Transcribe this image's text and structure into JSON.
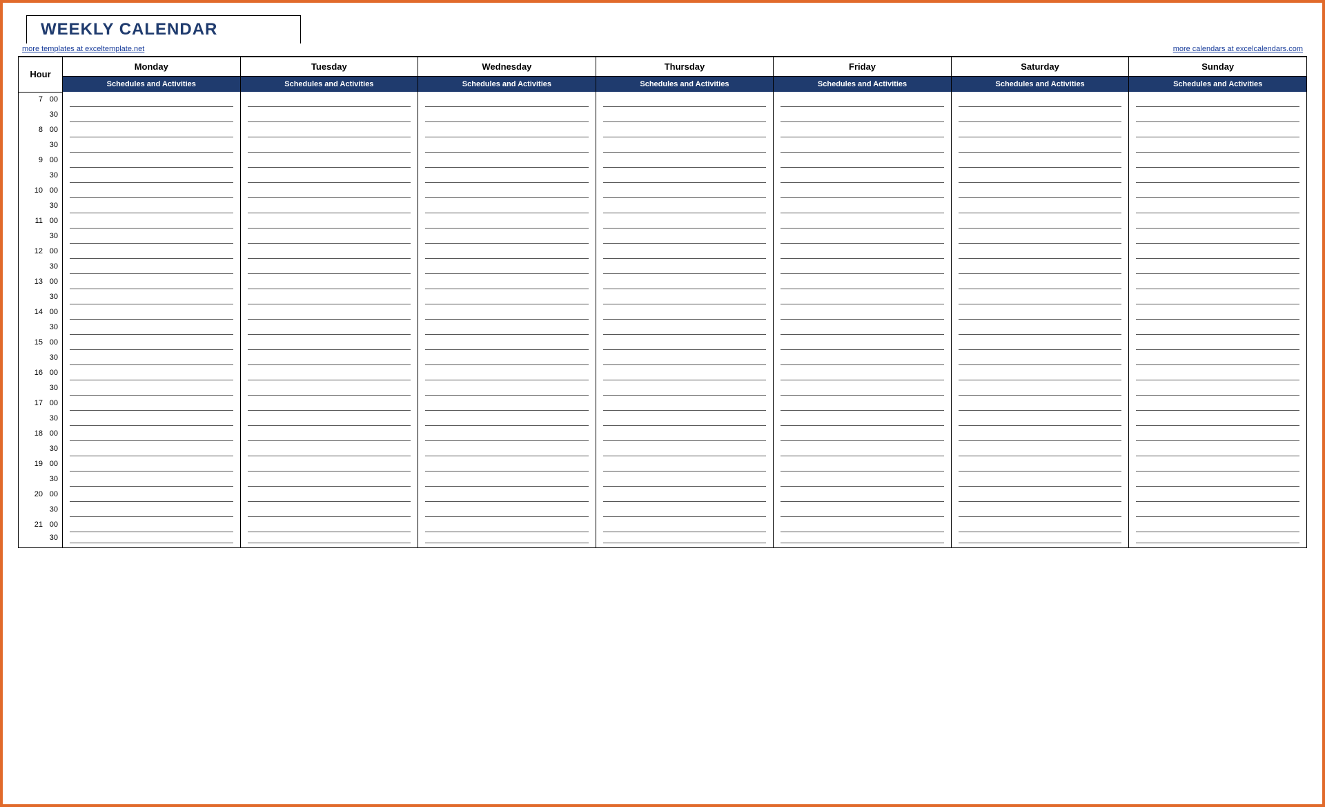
{
  "title": "WEEKLY CALENDAR",
  "link_left": "more templates at exceltemplate.net",
  "link_right": "more calendars at excelcalendars.com",
  "hour_label": "Hour",
  "subheader": "Schedules and Activities",
  "days": [
    "Monday",
    "Tuesday",
    "Wednesday",
    "Thursday",
    "Friday",
    "Saturday",
    "Sunday"
  ],
  "hours": [
    7,
    8,
    9,
    10,
    11,
    12,
    13,
    14,
    15,
    16,
    17,
    18,
    19,
    20,
    21
  ],
  "minutes": [
    "00",
    "30"
  ]
}
